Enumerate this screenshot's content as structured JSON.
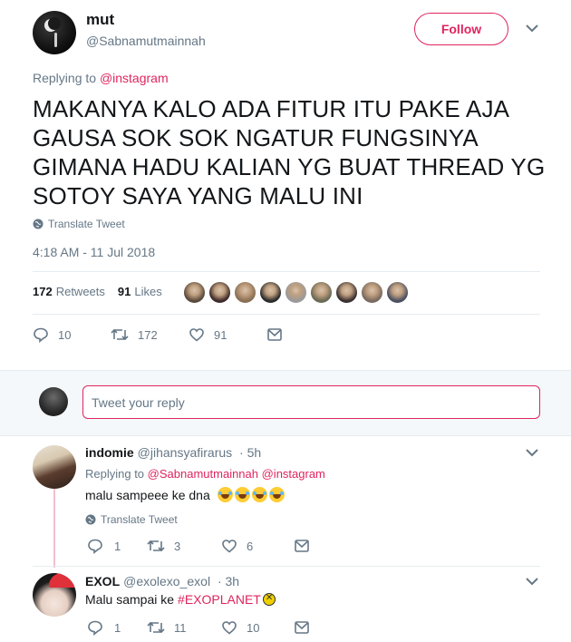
{
  "tweet": {
    "author_name": "mut",
    "author_handle": "@Sabnamutmainnah",
    "follow_label": "Follow",
    "replying_prefix": "Replying to",
    "replying_to": "@instagram",
    "text": "MAKANYA KALO ADA FITUR ITU PAKE AJA GAUSA SOK SOK NGATUR FUNGSINYA GIMANA HADU KALIAN YG BUAT THREAD YG SOTOY SAYA YANG MALU INI",
    "translate_label": "Translate Tweet",
    "timestamp": "4:18 AM - 11 Jul 2018",
    "retweets_count": "172",
    "retweets_label": "Retweets",
    "likes_count": "91",
    "likes_label": "Likes",
    "actions": {
      "replies": "10",
      "retweets": "172",
      "likes": "91"
    },
    "liker_avatar_colors": [
      "#5b4a3c",
      "#3d2a2a",
      "#8a6f55",
      "#2b2b2b",
      "#9a9a9a",
      "#6a6a55",
      "#3a3030",
      "#7a6a60",
      "#4a5060"
    ]
  },
  "compose": {
    "placeholder": "Tweet your reply"
  },
  "replies": [
    {
      "name": "indomie",
      "handle": "@jihansyafirarus",
      "time": "· 5h",
      "replying_prefix": "Replying to",
      "replying_to": "@Sabnamutmainnah @instagram",
      "text": "malu sampeee ke dna",
      "emoji_count": 4,
      "translate_label": "Translate Tweet",
      "actions": {
        "replies": "1",
        "retweets": "3",
        "likes": "6"
      }
    },
    {
      "name": "EXOL",
      "handle": "@exolexo_exol",
      "time": "· 3h",
      "text": "Malu sampai ke",
      "hashtag": "#EXOPLANET",
      "actions": {
        "replies": "1",
        "retweets": "11",
        "likes": "10"
      }
    }
  ],
  "colors": {
    "accent": "#e0245e",
    "muted": "#657786",
    "text": "#14171a",
    "divider": "#e6ecf0",
    "thread_line": "#f3bfcc"
  }
}
